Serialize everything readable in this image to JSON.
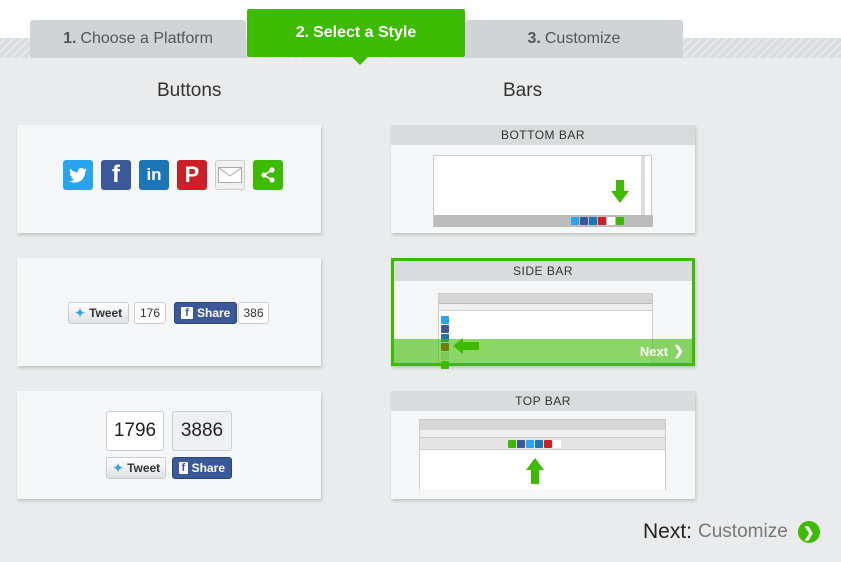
{
  "tabs": [
    {
      "num": "1.",
      "label": "Choose a Platform"
    },
    {
      "num": "2.",
      "label": "Select a Style"
    },
    {
      "num": "3.",
      "label": "Customize"
    }
  ],
  "columns": {
    "buttons": "Buttons",
    "bars": "Bars"
  },
  "style_small": {
    "tweet": "Tweet",
    "tweet_count": "176",
    "share": "Share",
    "share_count": "386"
  },
  "style_large": {
    "tweet_count": "1796",
    "share_count": "3886",
    "tweet": "Tweet",
    "share": "Share"
  },
  "bars": {
    "bottom": "BOTTOM BAR",
    "side": "SIDE BAR",
    "side_next": "Next",
    "top": "TOP BAR"
  },
  "footer": {
    "next": "Next:",
    "next_sub": "Customize"
  },
  "colors": {
    "accent": "#3cbb00",
    "twitter": "#2aa3ef",
    "facebook": "#3b5998",
    "linkedin": "#1c75b7",
    "pinterest": "#cb2027"
  }
}
